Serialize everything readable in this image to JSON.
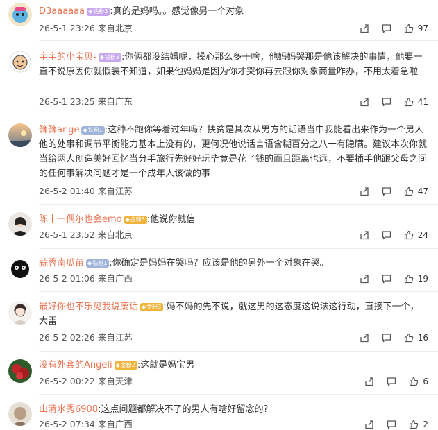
{
  "comments": [
    {
      "user": "D3aaaaaa",
      "badge": "钻粉3",
      "badge_color": "#c7a6f0",
      "sep": ":",
      "text": "真的是妈吗。。感觉像另一个对象",
      "date": "26-5-1 23:26",
      "location": "来自北京",
      "likes": "97"
    },
    {
      "user": "宇宇的小宝贝-",
      "badge": "钻粉3",
      "badge_color": "#c7a6f0",
      "sep": ":",
      "text": "你俩都没结婚呢，操心那么多干啥，他妈妈哭那是他该解决的事情，他要一直不说原因你就假装不知道，如果他妈妈是因为你才哭你再去跟你对象商量咋办，不用太着急啦",
      "date": "26-5-1 23:25",
      "location": "来自广东",
      "likes": "41"
    },
    {
      "user": "髀髀ange",
      "badge": "铁粉1",
      "badge_color": "#9fb4d8",
      "sep": ":",
      "text": "这种不跑你等着过年吗？扶贫是其次从男方的话语当中我能看出来作为一个男人他的处事和调节平衡能力基本上没有的，更何况他说话言语含糊百分之八十有隐瞒。建议本次你就当给两人创造美好回忆当分手旅行先好好玩毕竟是花了钱的而且距离也远，不要插手他跟父母之间的任何事解决问题才是一个成年人该做的事",
      "date": "26-5-2 01:40",
      "location": "来自江苏",
      "likes": "47"
    },
    {
      "user": "陈十一偶尔也会emo",
      "badge": "金粉3",
      "badge_color": "#f0b43c",
      "sep": ":",
      "text": "他说你就信",
      "date": "26-5-1 23:52",
      "location": "来自北京",
      "likes": "24"
    },
    {
      "user": "蒜蓉南瓜苗",
      "badge": "铁粉1",
      "badge_color": "#9fb4d8",
      "sep": ":",
      "text": "你确定是妈妈在哭吗？应该是他的另外一个对象在哭。",
      "date": "26-5-2 01:06",
      "location": "来自广西",
      "likes": "19"
    },
    {
      "user": "最好你也不乐见我说废话",
      "badge": "金粉3",
      "badge_color": "#f0b43c",
      "sep": ":",
      "text": "妈不妈的先不说，就这男的这态度这说法这行动，直接下一个，大雷",
      "date": "26-5-2 02:26",
      "location": "来自江苏",
      "likes": "16"
    },
    {
      "user": "没有外套的Angeli",
      "badge": "金粉2",
      "badge_color": "#f0b43c",
      "sep": ":",
      "text": "这就是妈宝男",
      "date": "26-5-2 00:22",
      "location": "来自天津",
      "likes": "6"
    },
    {
      "user": "山清水秀6908",
      "badge": "",
      "badge_color": "",
      "sep": ":",
      "text": "这点问题都解决不了的男人有啥好留念的?",
      "date": "26-5-2 07:34",
      "location": "来自广西",
      "likes": "2"
    }
  ],
  "icons": {
    "share": "share-icon",
    "reply": "comment-icon",
    "like": "thumbs-up-icon"
  },
  "colors": {
    "username": "#eb7350",
    "meta": "#555555"
  }
}
